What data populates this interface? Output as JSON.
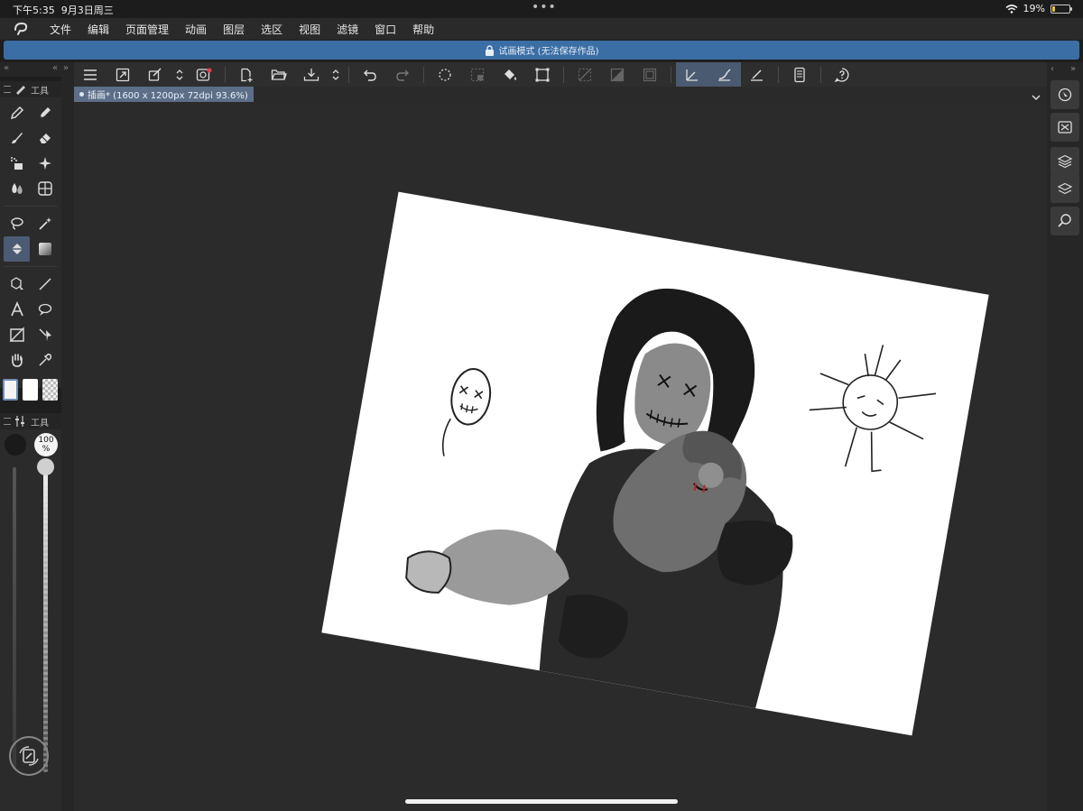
{
  "status": {
    "time": "下午5:35",
    "date": "9月3日周三",
    "battery_percent": "19%",
    "battery_level": 0.19
  },
  "menu": {
    "items": [
      "文件",
      "编辑",
      "页面管理",
      "动画",
      "图层",
      "选区",
      "视图",
      "滤镜",
      "窗口",
      "帮助"
    ]
  },
  "banner": {
    "text": "试画模式 (无法保存作品)"
  },
  "tool_panel": {
    "title": "工具"
  },
  "brush_panel": {
    "title": "工具",
    "opacity_value": "100",
    "opacity_unit": "%"
  },
  "document": {
    "tab_label": "插画* (1600 x 1200px 72dpi 93.6%)"
  },
  "colors": {
    "accent": "#3a6ea5",
    "tab_active": "#5c6e88",
    "tool_active": "#4b5b73",
    "battery": "#f2c230",
    "mouth_red": "#c0202a"
  }
}
